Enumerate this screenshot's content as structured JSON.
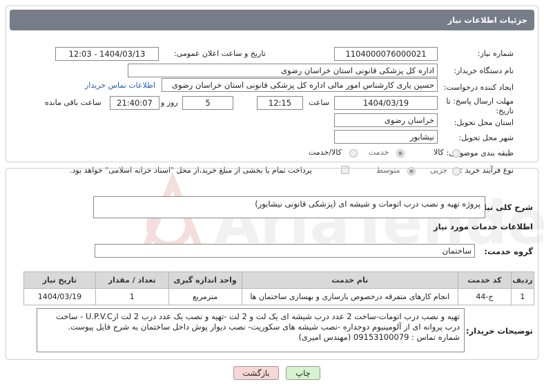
{
  "header": {
    "title": "جزئیات اطلاعات نیاز"
  },
  "watermark": {
    "text": "AriaTender.neT"
  },
  "form": {
    "need_number_label": "شماره نیاز:",
    "need_number": "1104000076000021",
    "announce_label": "تاریخ و ساعت اعلان عمومی:",
    "announce_value": "1404/03/13 - 12:03",
    "buyer_org_label": "نام دستگاه خریدار:",
    "buyer_org": "اداره کل پزشکی قانونی استان خراسان رضوی",
    "creator_label": "ایجاد کننده درخواست:",
    "creator": "حسین یاری کارشناس امور مالی اداره کل پزشکی قانونی استان خراسان رضوی",
    "buyer_contact_link": "اطلاعات تماس خریدار",
    "deadline_label_1": "مهلت ارسال پاسخ: تا",
    "deadline_label_2": "تاریخ:",
    "deadline_date": "1404/03/19",
    "time_label": "ساعت",
    "deadline_time": "12:15",
    "days_value": "5",
    "days_label": "روز و",
    "remaining_time": "21:40:07",
    "remaining_label": "ساعت باقی مانده",
    "province_label": "استان محل تحویل:",
    "province": "خراسان رضوی",
    "city_label": "شهر محل تحویل:",
    "city": "نیشابور",
    "category_label": "طبقه بندی موضوعی:",
    "category_options": [
      "کالا",
      "خدمت",
      "کالا/خدمت"
    ],
    "category_selected": "خدمت",
    "process_label": "نوع فرآیند خرید :",
    "process_options": [
      "جزیی",
      "متوسط"
    ],
    "process_selected": "متوسط",
    "payment_note": "پرداخت تمام یا بخشی از مبلغ خرید،از محل \"اسناد خزانه اسلامی\" خواهد بود."
  },
  "summary": {
    "label": "شرح کلی نیاز:",
    "value": "پروژه تهیه و نصب درب اتومات و شیشه ای (پزشکی قانونی نیشابور)"
  },
  "services": {
    "section_title": "اطلاعات خدمات مورد نیاز",
    "group_label": "گروه خدمت:",
    "group_value": "ساختمان",
    "columns": [
      "ردیف",
      "کد خدمت",
      "نام خدمت",
      "واحد اندازه گیری",
      "تعداد / مقدار",
      "تاریخ نیاز"
    ],
    "rows": [
      {
        "row": "1",
        "code": "ج-44",
        "name": "انجام کارهای متفرقه درخصوص بازسازی و بهسازی ساختمان ها",
        "unit": "مترمربع",
        "qty": "1",
        "date": "1404/03/19"
      }
    ]
  },
  "buyer_notes": {
    "label": "توضیحات خریدار:",
    "line1": "تهیه و نصب درب اتومات-ساخت 2 عدد درب شیشه ای یک لت و 2 لت -تهیه و نصب یک عدد درب 2 لت ازU.P.V.C - ساخت",
    "line2": "درب پروانه ای از آلومینیوم  دوجداره -نصب شیشه های سکوریت- نصب دیوار پوش داخل ساختمان به شرح فایل پیوست.",
    "line3": "شماره تماس : 09153100079 (مهندس امیری)"
  },
  "actions": {
    "print": "چاپ",
    "back": "بازگشت"
  },
  "colors": {
    "header_bg": "#767c88",
    "link": "#1b5fb6",
    "print_btn": "#d6f2cf",
    "back_btn": "#f7d6d6",
    "table_header": "#d9d9d9"
  }
}
